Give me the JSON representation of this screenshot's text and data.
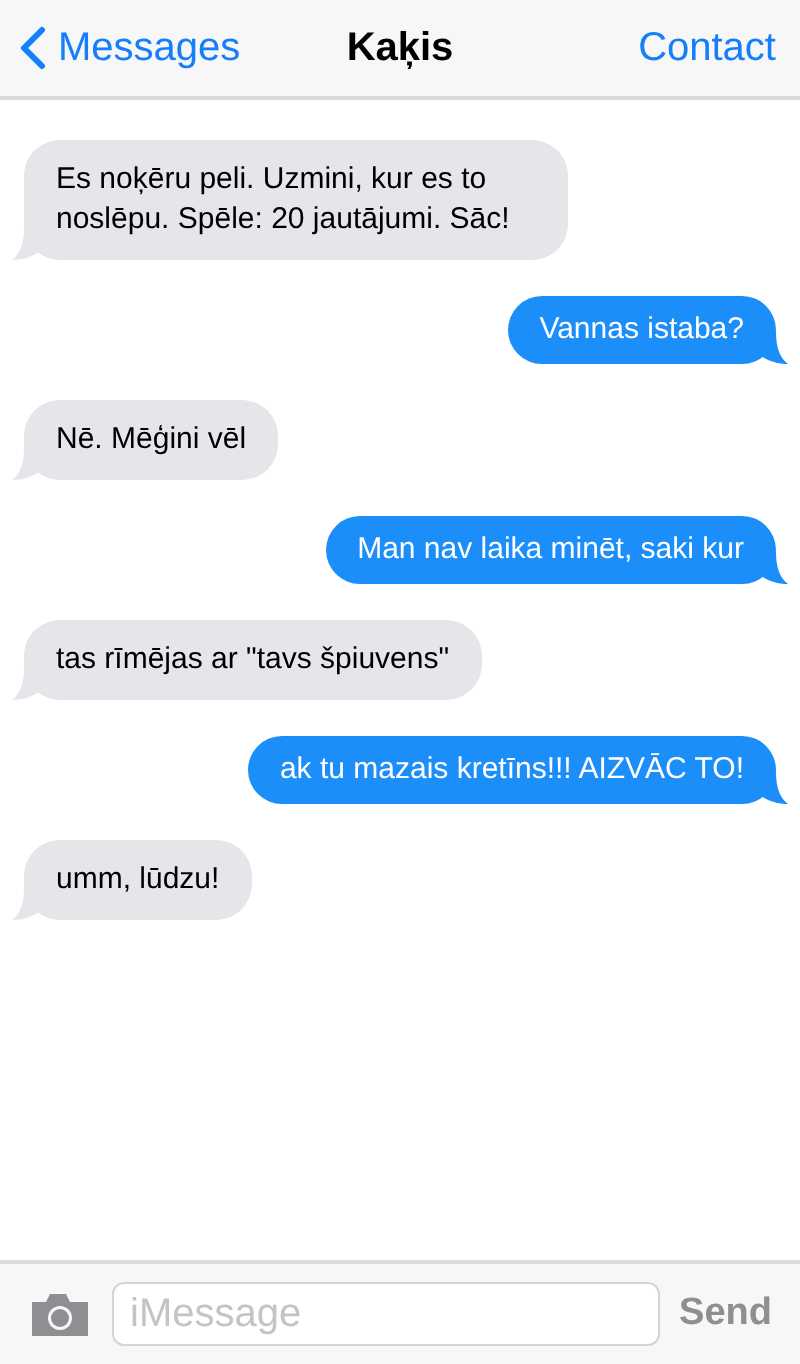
{
  "header": {
    "back": "Messages",
    "title": "Kaķis",
    "action": "Contact"
  },
  "messages": [
    {
      "kind": "received",
      "text": "Es noķēru peli. Uzmini, kur es to noslēpu. Spēle: 20 jautājumi. Sāc!"
    },
    {
      "kind": "sent",
      "text": "Vannas istaba?"
    },
    {
      "kind": "received",
      "text": "Nē. Mēģini vēl"
    },
    {
      "kind": "sent",
      "text": "Man nav laika minēt, saki kur"
    },
    {
      "kind": "received",
      "text": "tas rīmējas ar \"tavs špiuvens\""
    },
    {
      "kind": "sent",
      "text": "ak tu mazais kretīns!!! AIZVĀC TO!"
    },
    {
      "kind": "received",
      "text": "umm, lūdzu!"
    }
  ],
  "composer": {
    "placeholder": "iMessage",
    "send": "Send"
  }
}
